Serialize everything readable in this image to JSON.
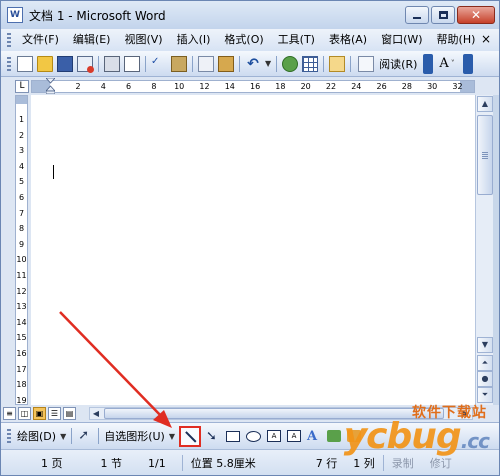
{
  "window": {
    "title": "文档 1 - Microsoft Word",
    "app_icon_label": "W"
  },
  "menubar": {
    "items": [
      "文件(F)",
      "编辑(E)",
      "视图(V)",
      "插入(I)",
      "格式(O)",
      "工具(T)",
      "表格(A)",
      "窗口(W)",
      "帮助(H)"
    ],
    "close_label": "×"
  },
  "toolbar": {
    "read_label": "阅读(R)",
    "font_size_label": "A"
  },
  "ruler": {
    "tab_selector": "L",
    "h_ticks": [
      "2",
      "4",
      "6",
      "8",
      "10",
      "12",
      "14",
      "16",
      "18",
      "20",
      "22",
      "24",
      "26",
      "28",
      "30",
      "32"
    ],
    "v_ticks": [
      "1",
      "2",
      "3",
      "4",
      "5",
      "6",
      "7",
      "8",
      "9",
      "10",
      "11",
      "12",
      "13",
      "14",
      "15",
      "16",
      "17",
      "18",
      "19"
    ]
  },
  "drawing_toolbar": {
    "draw_label": "绘图(D)",
    "autoshapes_label": "自选图形(U)"
  },
  "watermark": {
    "brand": "软件下载站",
    "logo": "ycbug",
    "logo_suffix": ".cc"
  },
  "statusbar": {
    "page": "1 页",
    "section": "1 节",
    "page_of": "1/1",
    "position": "位置 5.8厘米",
    "line": "7 行",
    "column": "1 列",
    "record": "录制",
    "revisions": "修订"
  },
  "colors": {
    "annotation": "#e02d22",
    "titlebar": "#c3d4ec",
    "close_button": "#c6412a"
  }
}
